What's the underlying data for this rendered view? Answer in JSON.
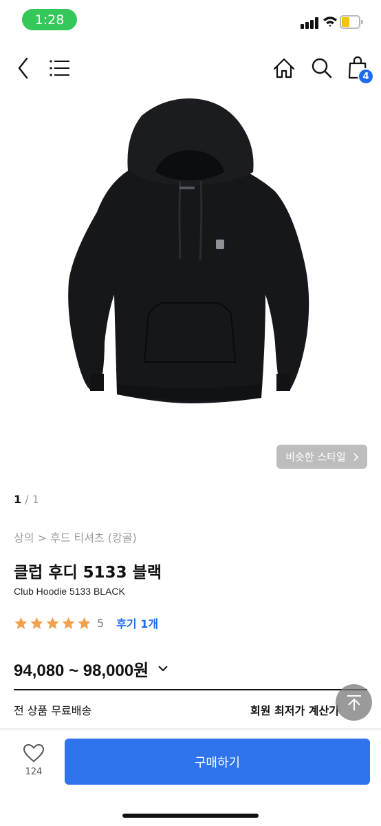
{
  "status_bar": {
    "time": "1:28"
  },
  "header": {
    "cart_count": "4",
    "icons": [
      "back-icon",
      "menu-icon",
      "home-icon",
      "search-icon",
      "shopping-bag-icon"
    ]
  },
  "gallery": {
    "similar_style_label": "비슷한 스타일",
    "current_page": "1",
    "page_separator": "/",
    "total_pages": "1"
  },
  "product": {
    "breadcrumb": "상의 > 후드 티셔츠 (캉골)",
    "name_ko": "클럽 후디 5133 블랙",
    "name_en": "Club Hoodie 5133 BLACK",
    "rating_value": "5",
    "stars": 5,
    "review_label": "후기 1개",
    "price_range": "94,080 ~ 98,000원",
    "shipping_note": "전 상품 무료배송",
    "member_price_calc": "회원 최저가 계산기"
  },
  "bottom_bar": {
    "like_count": "124",
    "buy_label": "구매하기"
  },
  "colors": {
    "accent": "#2f74ec",
    "badge": "#1e6bef",
    "star": "#f5a04a",
    "status_pill": "#34c759"
  }
}
